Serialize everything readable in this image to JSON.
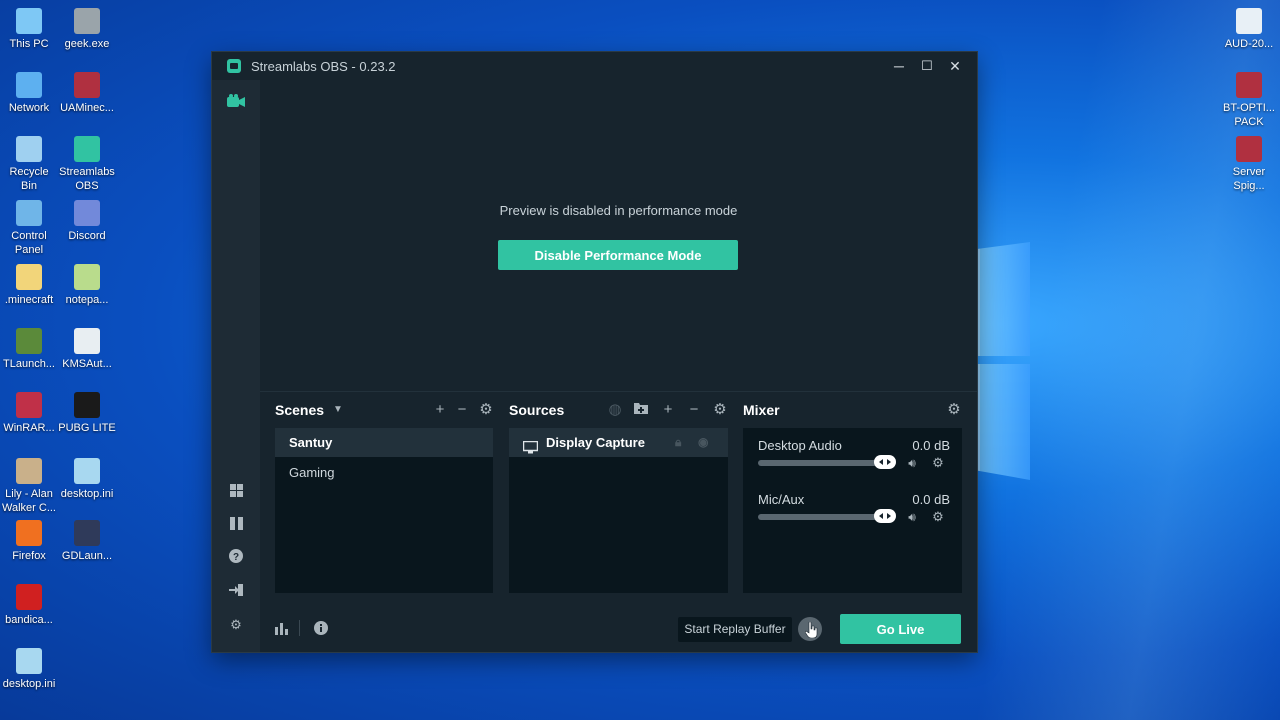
{
  "desktop": {
    "icons_left": [
      {
        "label": "This PC",
        "icon": "computer-icon"
      },
      {
        "label": "geek.exe",
        "icon": "exe-icon"
      },
      {
        "label": "Network",
        "icon": "network-icon"
      },
      {
        "label": "UAMinec...",
        "icon": "winrar-archive-icon"
      },
      {
        "label": "Recycle Bin",
        "icon": "recycle-bin-icon"
      },
      {
        "label": "Streamlabs OBS",
        "icon": "streamlabs-icon"
      },
      {
        "label": "Control Panel",
        "icon": "control-panel-icon"
      },
      {
        "label": "Discord",
        "icon": "discord-icon"
      },
      {
        "label": ".minecraft",
        "icon": "folder-icon"
      },
      {
        "label": "notepa...",
        "icon": "notepad-icon"
      },
      {
        "label": "TLaunch...",
        "icon": "tlauncher-icon"
      },
      {
        "label": "KMSAut...",
        "icon": "file-icon"
      },
      {
        "label": "WinRAR...",
        "icon": "winrar-icon"
      },
      {
        "label": "PUBG LITE",
        "icon": "pubg-icon"
      },
      {
        "label": "Lily - Alan Walker C...",
        "icon": "video-icon"
      },
      {
        "label": "desktop.ini",
        "icon": "settings-file-icon"
      },
      {
        "label": "Firefox",
        "icon": "firefox-icon"
      },
      {
        "label": "GDLaun...",
        "icon": "gdlauncher-icon"
      },
      {
        "label": "bandica...",
        "icon": "bandicam-icon"
      },
      {
        "label": "desktop.ini",
        "icon": "settings-file-icon"
      }
    ],
    "icons_right": [
      {
        "label": "AUD-20...",
        "icon": "audio-file-icon"
      },
      {
        "label": "BT-OPTI... PACK",
        "icon": "winrar-archive-icon"
      },
      {
        "label": "Server Spig...",
        "icon": "winrar-archive-icon"
      }
    ]
  },
  "window": {
    "title": "Streamlabs OBS - 0.23.2",
    "minimize": "─",
    "maximize": "☐",
    "close": "✕"
  },
  "preview": {
    "message": "Preview is disabled in performance mode",
    "button": "Disable Performance Mode"
  },
  "scenes": {
    "header": "Scenes",
    "items": [
      "Santuy",
      "Gaming"
    ],
    "active": "Santuy"
  },
  "sources": {
    "header": "Sources",
    "items": [
      {
        "label": "Display Capture",
        "icon": "monitor-icon"
      }
    ]
  },
  "mixer": {
    "header": "Mixer",
    "channels": [
      {
        "name": "Desktop Audio",
        "level": "0.0 dB"
      },
      {
        "name": "Mic/Aux",
        "level": "0.0 dB"
      }
    ]
  },
  "footer": {
    "replay_tooltip": "Start Replay Buffer",
    "go_live": "Go Live"
  },
  "colors": {
    "accent": "#31c3a2",
    "window_bg": "#17242d",
    "panel_bg": "#09161d",
    "sidebar_bg": "#1e2b35"
  }
}
